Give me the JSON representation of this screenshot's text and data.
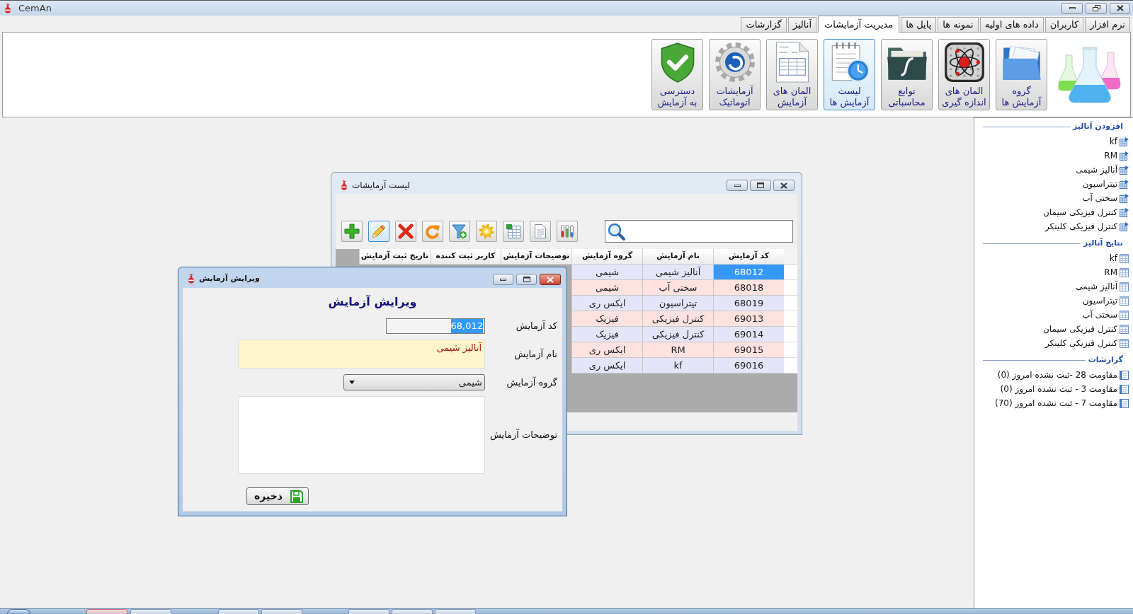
{
  "window": {
    "title": "CemAn"
  },
  "tabs": [
    {
      "label": "نرم افزار",
      "selected": false
    },
    {
      "label": "کاربران",
      "selected": false
    },
    {
      "label": "داده های اولیه",
      "selected": false
    },
    {
      "label": "نمونه ها",
      "selected": false
    },
    {
      "label": "پایل ها",
      "selected": false
    },
    {
      "label": "مدیریت آزمایشات",
      "selected": true
    },
    {
      "label": "آنالیز",
      "selected": false
    },
    {
      "label": "گزارشات",
      "selected": false
    }
  ],
  "ribbon": {
    "buttons": [
      {
        "lines": [
          "گروه",
          "آزمایش ها"
        ],
        "selected": false
      },
      {
        "lines": [
          "المان های",
          "اندازه گیری"
        ],
        "selected": false
      },
      {
        "lines": [
          "توابع",
          "محاسباتی"
        ],
        "selected": false
      },
      {
        "lines": [
          "لیست",
          "آزمایش ها"
        ],
        "selected": true
      },
      {
        "lines": [
          "المان های",
          "آزمایش"
        ],
        "selected": false
      },
      {
        "lines": [
          "آزمایشات",
          "اتوماتیک"
        ],
        "selected": false
      },
      {
        "lines": [
          "دسترسی",
          "به آزمایش"
        ],
        "selected": false
      }
    ]
  },
  "list_window": {
    "title": "لیست آزمایشات",
    "active": false,
    "toolbar": [
      {
        "highlighted": false
      },
      {
        "highlighted": true
      },
      {
        "highlighted": false
      },
      {
        "highlighted": false
      },
      {
        "highlighted": false
      },
      {
        "highlighted": false
      },
      {
        "highlighted": false
      },
      {
        "highlighted": false
      },
      {
        "highlighted": false
      }
    ],
    "table": {
      "columns": [
        "کد آزمایش",
        "نام آزمایش",
        "گروه آزمایش",
        "توضیحات آزمایش",
        "کاربر ثبت کننده",
        "تاریخ ثبت آزمایش"
      ],
      "rows": [
        {
          "cells": [
            "68012",
            "آنالیز شیمی",
            "شیمی"
          ],
          "selected": true
        },
        {
          "cells": [
            "68018",
            "سختی آب",
            "شیمی"
          ],
          "selected": false
        },
        {
          "cells": [
            "68019",
            "تیتراسیون",
            "ایکس ری"
          ],
          "selected": false
        },
        {
          "cells": [
            "69013",
            "کنترل فیزیکی",
            "فیزیک"
          ],
          "selected": false
        },
        {
          "cells": [
            "69014",
            "کنترل فیزیکی",
            "فیزیک"
          ],
          "selected": false
        },
        {
          "cells": [
            "69015",
            "RM",
            "ایکس ری"
          ],
          "selected": false
        },
        {
          "cells": [
            "69016",
            "kf",
            "ایکس ری"
          ],
          "selected": false
        }
      ]
    }
  },
  "edit_dialog": {
    "title": "ویرایش آزمایش",
    "active": true,
    "heading": "ویرایش آزمایش",
    "fields": [
      {
        "kind": "text",
        "label": "کد آزمایش",
        "value": "68,012",
        "text_selected": true,
        "highlighted": false
      },
      {
        "kind": "memo",
        "label": "نام آزمایش",
        "value": "آنالیز شیمی",
        "text_selected": false,
        "highlighted": true
      },
      {
        "kind": "combo",
        "label": "گروه آزمایش",
        "value": "شیمی",
        "text_selected": false,
        "highlighted": false
      },
      {
        "kind": "textarea",
        "label": "توضیحات آزمایش",
        "highlighted": false
      }
    ],
    "save_button": "ذخیره"
  },
  "sidebar": {
    "sections": [
      {
        "kind": "add",
        "title": "افزودن آنالیز",
        "items": [
          "kf",
          "RM",
          "آنالیز شیمی",
          "تیتراسیون",
          "سختی آب",
          "کنترل فیزیکی سیمان",
          "کنترل فیزیکی کلینکر"
        ]
      },
      {
        "kind": "result",
        "title": "نتایج آنالیز",
        "items": [
          "kf",
          "RM",
          "آنالیز شیمی",
          "تیتراسیون",
          "سختی آب",
          "کنترل فیزیکی سیمان",
          "کنترل فیزیکی کلینکر"
        ]
      },
      {
        "kind": "report",
        "title": "گزارشات",
        "items": [
          "مقاومت 28 -ثبت نشده امروز (0)",
          "مقاومت 3 - ثبت نشده امروز (0)",
          "مقاومت 7 - ثبت نشده امروز (70)"
        ]
      }
    ]
  },
  "taskbar": {
    "buttons": [
      {
        "selected": true
      },
      {
        "selected": false
      },
      {
        "selected": false
      },
      {
        "selected": false
      },
      {
        "selected": false
      },
      {
        "selected": false
      },
      {
        "selected": false
      }
    ]
  }
}
